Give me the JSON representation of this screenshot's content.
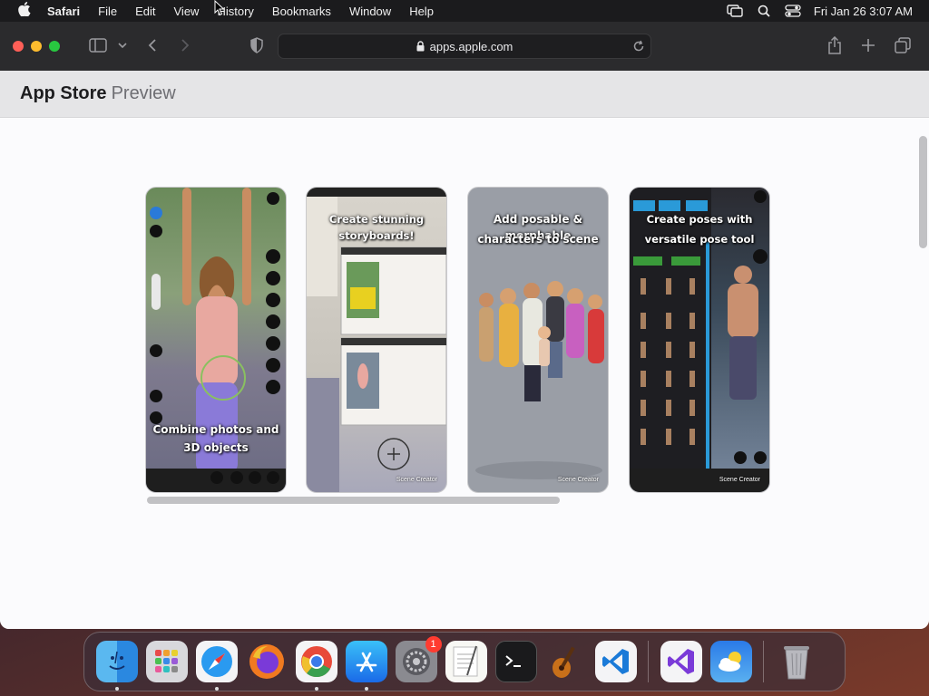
{
  "menubar": {
    "app_name": "Safari",
    "items": [
      "File",
      "Edit",
      "View",
      "History",
      "Bookmarks",
      "Window",
      "Help"
    ],
    "datetime": "Fri Jan 26  3:07 AM",
    "icons": [
      "apple-icon",
      "screen-mirroring-icon",
      "search-icon",
      "control-center-icon"
    ]
  },
  "toolbar": {
    "url": "apps.apple.com",
    "icons": [
      "sidebar-icon",
      "chevron-down-icon",
      "back-icon",
      "forward-icon",
      "privacy-shield-icon",
      "lock-icon",
      "reload-icon",
      "share-icon",
      "new-tab-icon",
      "tab-overview-icon"
    ]
  },
  "store_header": {
    "title": "App Store",
    "subtitle": "Preview"
  },
  "screenshots": [
    {
      "caption_line1": "Combine photos and",
      "caption_line2": "3D objects",
      "watermark": ""
    },
    {
      "caption_line1": "Create stunning storyboards!",
      "caption_line2": "",
      "watermark": "Scene Creator"
    },
    {
      "caption_line1": "Add posable & morphable",
      "caption_line2": "characters to scene",
      "watermark": "Scene Creator"
    },
    {
      "caption_line1": "Create poses with",
      "caption_line2": "versatile pose tool",
      "watermark": "Scene Creator"
    }
  ],
  "scroll": {
    "horizontal_position": 0.0,
    "horizontal_visible_fraction": 0.66
  },
  "dock": {
    "apps": [
      {
        "name": "Finder",
        "icon": "finder-icon",
        "running": true
      },
      {
        "name": "Launchpad",
        "icon": "launchpad-icon",
        "running": false
      },
      {
        "name": "Safari",
        "icon": "safari-icon",
        "running": true
      },
      {
        "name": "Firefox",
        "icon": "firefox-icon",
        "running": false
      },
      {
        "name": "Chrome",
        "icon": "chrome-icon",
        "running": true
      },
      {
        "name": "App Store",
        "icon": "app-store-icon",
        "running": true
      },
      {
        "name": "System Settings",
        "icon": "settings-icon",
        "running": false,
        "badge": "1"
      },
      {
        "name": "TextEdit",
        "icon": "textedit-icon",
        "running": false
      },
      {
        "name": "Terminal",
        "icon": "terminal-icon",
        "running": false
      },
      {
        "name": "GarageBand",
        "icon": "garageband-icon",
        "running": false
      },
      {
        "name": "VS Code",
        "icon": "vscode-icon",
        "running": false
      },
      {
        "name": "Visual Studio",
        "icon": "visual-studio-icon",
        "running": false
      },
      {
        "name": "Weather",
        "icon": "weather-icon",
        "running": false
      },
      {
        "name": "Trash",
        "icon": "trash-icon",
        "running": false
      }
    ]
  },
  "colors": {
    "close": "#ff5f57",
    "minimize": "#febc2e",
    "zoom": "#28c840",
    "toolbar_bg": "#2b2b2d",
    "menubar_bg": "#1b1b1d",
    "store_header_bg": "#e5e5e7"
  }
}
